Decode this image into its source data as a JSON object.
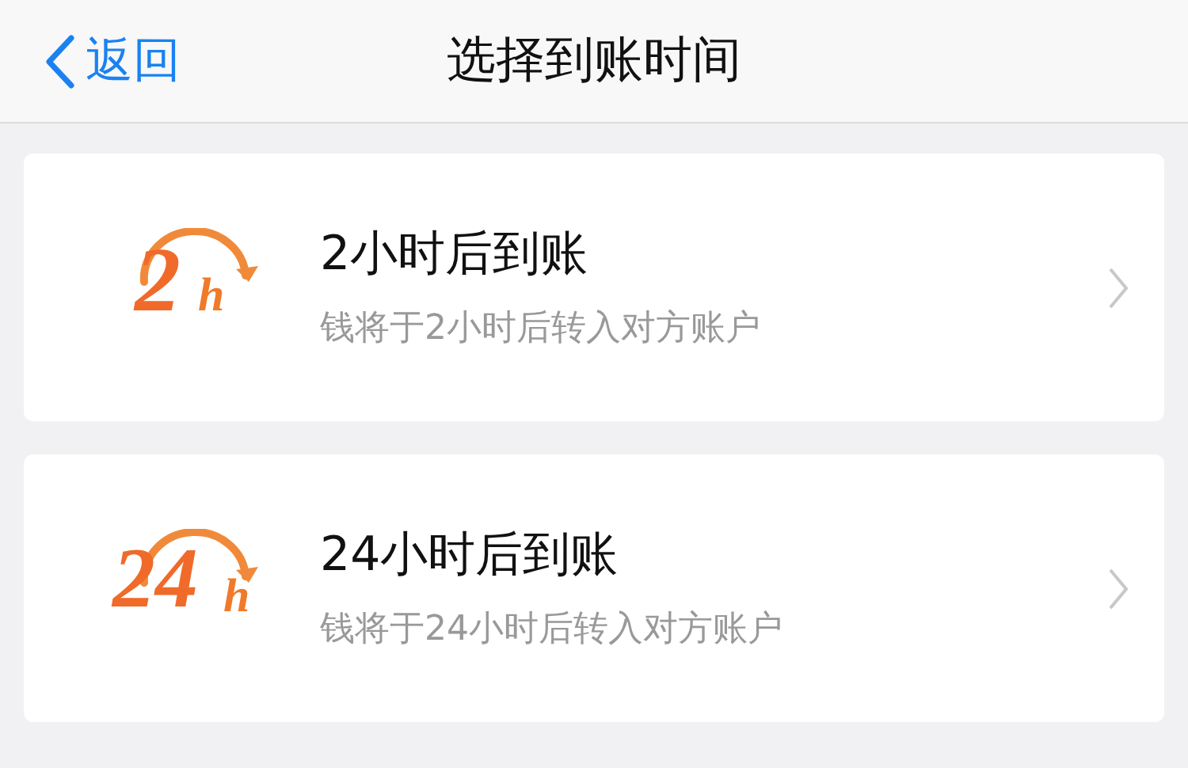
{
  "nav_bar": {
    "back_label": "返回",
    "title": "选择到账时间"
  },
  "options": [
    {
      "badge_number": "2",
      "badge_unit": "h",
      "title": "2小时后到账",
      "subtitle": "钱将于2小时后转入对方账户"
    },
    {
      "badge_number": "24",
      "badge_unit": "h",
      "title": "24小时后到账",
      "subtitle": "钱将于24小时后转入对方账户"
    }
  ]
}
